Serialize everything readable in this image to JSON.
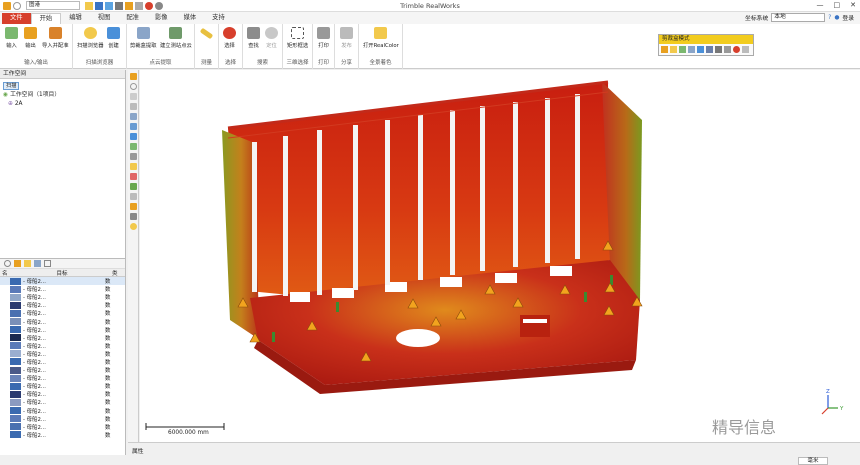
{
  "window": {
    "title": "Trimble RealWorks",
    "min": "—",
    "max": "□",
    "close": "✕"
  },
  "quick_access": {
    "project_name": "图港"
  },
  "tabs": [
    "文件",
    "开始",
    "编辑",
    "视图",
    "配准",
    "影像",
    "媒体",
    "支持"
  ],
  "active_tab": "开始",
  "coord_system": {
    "label": "坐标系统",
    "value": "本地",
    "user": "登录"
  },
  "ribbon": {
    "groups": [
      {
        "label": "输入/输出",
        "buttons": [
          "输入",
          "输出",
          "导入并配准"
        ]
      },
      {
        "label": "扫描浏览器",
        "buttons": [
          "扫描浏览器",
          "创建"
        ]
      },
      {
        "label": "点云提取",
        "buttons": [
          "剪裁盒提取",
          "建立测站点云"
        ]
      },
      {
        "label": "测量",
        "buttons": [
          ""
        ]
      },
      {
        "label": "选择",
        "buttons": [
          "选择"
        ]
      },
      {
        "label": "搜索",
        "buttons": [
          "查找",
          "定位"
        ]
      },
      {
        "label": "三维选择",
        "buttons": [
          "矩形框选"
        ]
      },
      {
        "label": "打印",
        "buttons": [
          "打印"
        ]
      },
      {
        "label": "分享",
        "buttons": [
          "发布"
        ]
      },
      {
        "label": "全景着色",
        "buttons": [
          "打开RealColor"
        ]
      }
    ]
  },
  "segmentation_panel": {
    "title": "剪裁盒模式"
  },
  "workspace": {
    "title": "工作空间",
    "tree_tab": "扫描",
    "root": "工作空间（1项目）",
    "child": "2A",
    "list_headers": [
      "名",
      "目标",
      "类"
    ],
    "rows": [
      {
        "name": "- 母船2...",
        "type": "数"
      },
      {
        "name": "- 母船2...",
        "type": "数"
      },
      {
        "name": "- 母船2...",
        "type": "数"
      },
      {
        "name": "- 母船2...",
        "type": "数"
      },
      {
        "name": "- 母船2...",
        "type": "数"
      },
      {
        "name": "- 母船2...",
        "type": "数"
      },
      {
        "name": "- 母船2...",
        "type": "数"
      },
      {
        "name": "- 母船2...",
        "type": "数"
      },
      {
        "name": "- 母船2...",
        "type": "数"
      },
      {
        "name": "- 母船2...",
        "type": "数"
      },
      {
        "name": "- 母船2...",
        "type": "数"
      },
      {
        "name": "- 母船2...",
        "type": "数"
      },
      {
        "name": "- 母船2...",
        "type": "数"
      },
      {
        "name": "- 母船2...",
        "type": "数"
      },
      {
        "name": "- 母船2...",
        "type": "数"
      },
      {
        "name": "- 母船2...",
        "type": "数"
      },
      {
        "name": "- 母船2...",
        "type": "数"
      },
      {
        "name": "- 母船2...",
        "type": "数"
      },
      {
        "name": "- 母船2...",
        "type": "数"
      },
      {
        "name": "- 母船2...",
        "type": "数"
      }
    ]
  },
  "viewport": {
    "scale_text": "6000.000 mm",
    "axis_z": "Z",
    "axis_y": "Y",
    "watermark": "精导信息"
  },
  "status": {
    "properties": "属性",
    "units": "毫米"
  },
  "colors": {
    "accent": "#d73f2c",
    "highlight": "#f2cc1e",
    "selection": "#dbe8f7"
  }
}
